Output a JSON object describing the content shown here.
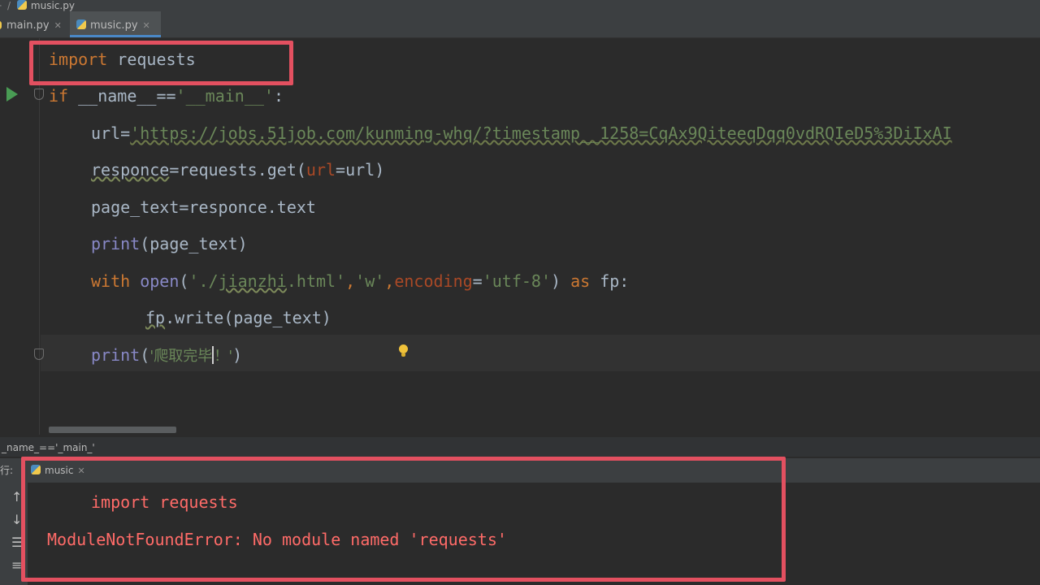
{
  "breadcrumb": {
    "file": "music.py"
  },
  "tabs": [
    {
      "label": "main.py",
      "active": false
    },
    {
      "label": "music.py",
      "active": true
    }
  ],
  "code": {
    "l1_import": "import",
    "l1_module": " requests",
    "l2_if": "if",
    "l2_cond": " __name__==",
    "l2_str": "'__main__'",
    "l2_colon": ":",
    "l3_var": "url",
    "l3_eq": "=",
    "l3_url": "'https://jobs.51job.com/kunming-whq/?timestamp__1258=CqAx9QiteeqDqq0vdRQIeD5%3DiIxAI",
    "l4_var": "responce",
    "l4_rest": "=requests.get(",
    "l4_param": "url",
    "l4_end": "=url)",
    "l5_text": "page_text=responce.text",
    "l6_print": "print",
    "l6_rest": "(page_text)",
    "l7_with": "with ",
    "l7_open": "open",
    "l7_p1": "(",
    "l7_s1a": "'./",
    "l7_s1b": "jianzhi",
    "l7_s1c": ".html'",
    "l7_c1": ",",
    "l7_s2": "'w'",
    "l7_c2": ",",
    "l7_enc": "encoding",
    "l7_eq": "=",
    "l7_s3": "'utf-8'",
    "l7_p2": ") ",
    "l7_as": "as",
    "l7_fp": " fp:",
    "l8_fp": "fp",
    "l8_rest": ".write(page_text)",
    "l9_print": "print",
    "l9_p1": "(",
    "l9_s1": "'爬取完毕",
    "l9_s2": "！'",
    "l9_p2": ")"
  },
  "status": {
    "crumb": "_name_=='_main_'"
  },
  "run": {
    "label": "行:",
    "tab": "music",
    "line1": "import requests",
    "line2": "ModuleNotFoundError: No module named 'requests'"
  }
}
